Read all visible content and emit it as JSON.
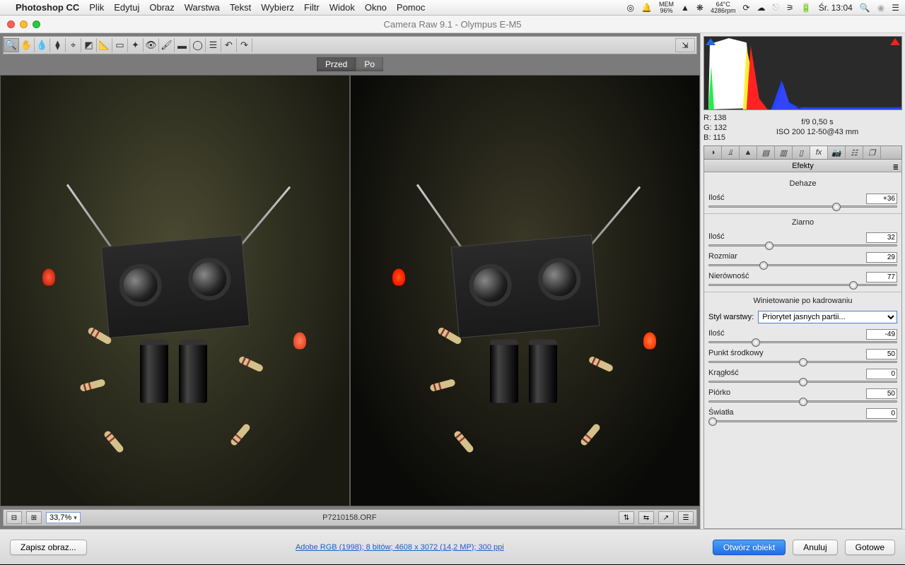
{
  "menubar": {
    "app": "Photoshop CC",
    "items": [
      "Plik",
      "Edytuj",
      "Obraz",
      "Warstwa",
      "Tekst",
      "Wybierz",
      "Filtr",
      "Widok",
      "Okno",
      "Pomoc"
    ],
    "mem_label": "MEM",
    "mem_val": "96%",
    "temp": "64°C",
    "rpm": "4286rpm",
    "date": "Śr. 13:04"
  },
  "window": {
    "title": "Camera Raw 9.1  -  Olympus E-M5"
  },
  "preview": {
    "tab_before": "Przed",
    "tab_after": "Po",
    "zoom_minus": "⊟",
    "zoom_plus": "⊞",
    "zoom": "33,7%",
    "filename": "P7210158.ORF"
  },
  "rgb": {
    "r_lbl": "R:",
    "r": "138",
    "g_lbl": "G:",
    "g": "132",
    "b_lbl": "B:",
    "b": "115"
  },
  "exif": {
    "line1": "f/9   0,50 s",
    "line2": "ISO 200   12-50@43 mm"
  },
  "panel": {
    "title": "Efekty",
    "dehaze": {
      "title": "Dehaze",
      "amount_lbl": "Ilość",
      "amount": "+36",
      "amount_pct": 68
    },
    "grain": {
      "title": "Ziarno",
      "amount_lbl": "Ilość",
      "amount": "32",
      "amount_pct": 32,
      "size_lbl": "Rozmiar",
      "size": "29",
      "size_pct": 29,
      "rough_lbl": "Nierówność",
      "rough": "77",
      "rough_pct": 77
    },
    "vignette": {
      "title": "Winietowanie po kadrowaniu",
      "style_lbl": "Styl warstwy:",
      "style": "Priorytet jasnych partii...",
      "amount_lbl": "Ilość",
      "amount": "-49",
      "amount_pct": 25,
      "mid_lbl": "Punkt środkowy",
      "mid": "50",
      "mid_pct": 50,
      "round_lbl": "Krągłość",
      "round": "0",
      "round_pct": 50,
      "feather_lbl": "Piórko",
      "feather": "50",
      "feather_pct": 50,
      "high_lbl": "Światła",
      "high": "0",
      "high_pct": 2
    }
  },
  "footer": {
    "save": "Zapisz obraz...",
    "meta": "Adobe RGB (1998); 8 bitów; 4608 x 3072 (14,2 MP); 300 ppi",
    "open": "Otwórz obiekt",
    "cancel": "Anuluj",
    "done": "Gotowe"
  }
}
